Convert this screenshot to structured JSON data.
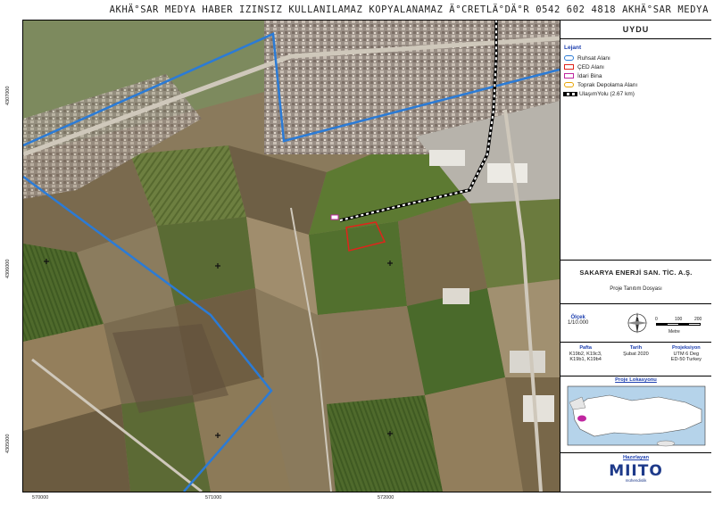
{
  "watermark": "AKHÄ°SAR MEDYA HABER IZINSIZ KULLANILAMAZ KOPYALANAMAZ  Ä°CRETLÄ°DÄ°R  0542 602 4818  AKHÄ°SAR MEDYA",
  "panel_title": "UYDU",
  "legend": {
    "title": "Lejant",
    "items": [
      {
        "label": "Ruhsat Alanı",
        "color": "#2b7bd6"
      },
      {
        "label": "ÇED Alanı",
        "color": "#e0241b"
      },
      {
        "label": "İdari Bina",
        "color": "#c026a0"
      },
      {
        "label": "Toprak Depolama Alanı",
        "color": "#e9a400"
      }
    ],
    "road_label": "UlaşımYolu (2.67 km)"
  },
  "company": {
    "name": "SAKARYA ENERJİ SAN. TİC. A.Ş.",
    "subtitle": "Proje Tanıtım Dosyası"
  },
  "scale": {
    "title": "Ölçek",
    "value": "1/10.000",
    "ticks": [
      "0",
      "100",
      "200"
    ],
    "unit": "Metre",
    "compass_n": "N"
  },
  "info": [
    {
      "header": "Pafta",
      "lines": [
        "K19b2, K19c3,",
        "K19b1, K19b4"
      ]
    },
    {
      "header": "Tarih",
      "lines": [
        "Şubat 2020"
      ]
    },
    {
      "header": "Projeksiyon",
      "lines": [
        "UTM 6 Deg",
        "ED-50 Turkey"
      ]
    }
  ],
  "location": {
    "header": "Proje Lokasyonu"
  },
  "prepared": {
    "header": "Hazırlayan",
    "logo": "MIITO",
    "logo_sub": "mühendislik"
  },
  "axis": {
    "x": [
      "570000",
      "571000",
      "572000"
    ],
    "y": [
      "4307000",
      "4306000",
      "4305000"
    ]
  },
  "colors": {
    "license": "#2b7bd6",
    "ced": "#e0241b"
  }
}
